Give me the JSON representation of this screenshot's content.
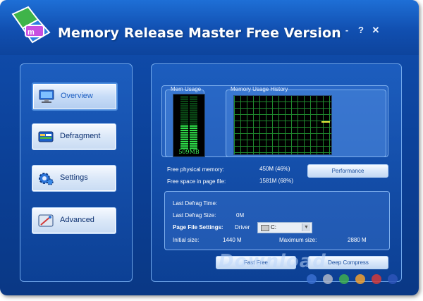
{
  "app": {
    "title": "Memory Release Master Free Version",
    "controls": {
      "minimize": "-",
      "help": "?",
      "close": "✕"
    }
  },
  "nav": {
    "items": [
      {
        "label": "Overview",
        "icon": "monitor-icon",
        "active": true
      },
      {
        "label": "Defragment",
        "icon": "defragment-icon",
        "active": false
      },
      {
        "label": "Settings",
        "icon": "gear-icon",
        "active": false
      },
      {
        "label": "Advanced",
        "icon": "advanced-tools-icon",
        "active": false
      }
    ]
  },
  "monitor": {
    "mem_usage_label": "Mem Usage",
    "history_label": "Memory Usage History",
    "mem_value": "509MB",
    "mem_fill_percent": 46
  },
  "stats": {
    "free_physical_label": "Free physical memory:",
    "free_physical_value": "450M (46%)",
    "free_page_label": "Free space in page file:",
    "free_page_value": "1581M (68%)",
    "performance_button": "Performance"
  },
  "defrag_info": {
    "last_time_label": "Last Defrag Time:",
    "last_time_value": "",
    "last_size_label": "Last Defrag Size:",
    "last_size_value": "0M",
    "page_file_settings_label": "Page File Settings:",
    "driver_label": "Driver",
    "driver_value": "C:",
    "initial_size_label": "Initial size:",
    "initial_size_value": "1440 M",
    "max_size_label": "Maximum size:",
    "max_size_value": "2880 M"
  },
  "actions": {
    "fast_free": "Fast Free",
    "deep_compress": "Deep Compress"
  },
  "watermark": {
    "text": "Download.com.vn",
    "dot_colors": [
      "#3a6fd0",
      "#aeb6c8",
      "#3fae4f",
      "#f0a030",
      "#d23a3a",
      "#2e55b8"
    ]
  }
}
